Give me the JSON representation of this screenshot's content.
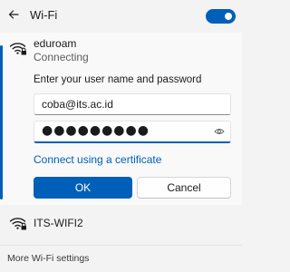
{
  "header": {
    "title": "Wi-Fi",
    "back_icon": "arrow-left-icon",
    "toggle_on": true
  },
  "active_network": {
    "name": "eduroam",
    "status": "Connecting",
    "prompt": "Enter your user name and password",
    "username_value": "coba@its.ac.id",
    "password_mask": "●●●●●●●●●",
    "reveal_icon": "eye-icon",
    "cert_link": "Connect using a certificate",
    "ok_label": "OK",
    "cancel_label": "Cancel"
  },
  "networks": [
    {
      "name": "ITS-WIFI2",
      "icon": "wifi-secured-icon"
    }
  ],
  "footer": {
    "more_settings": "More Wi-Fi settings"
  },
  "colors": {
    "accent": "#005fb8",
    "background": "#f3f3f3",
    "card": "#f9f9f9"
  }
}
